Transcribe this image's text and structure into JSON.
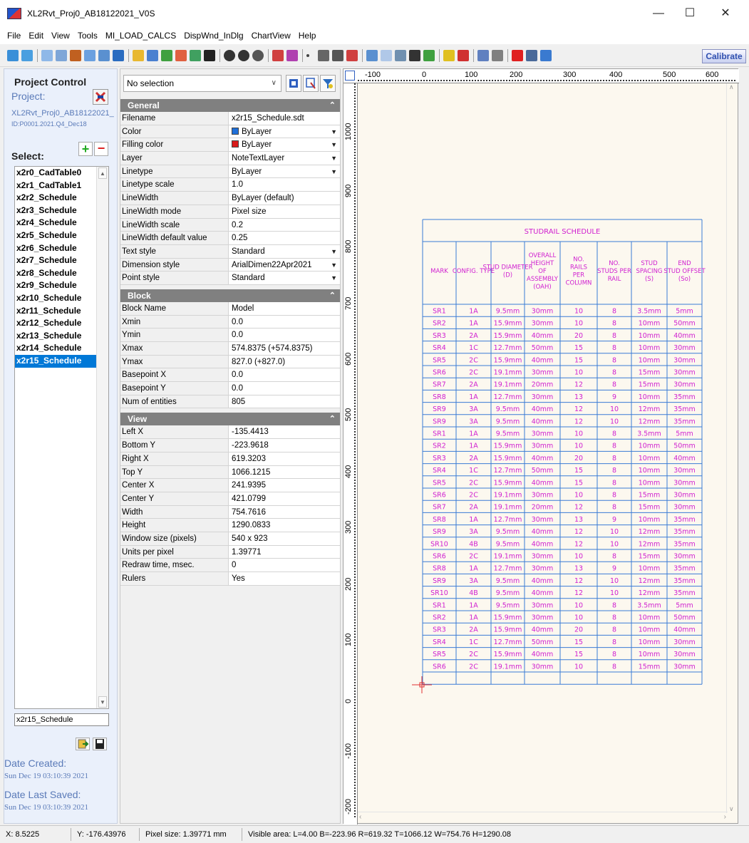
{
  "window": {
    "title": "XL2Rvt_Proj0_AB18122021_V0S",
    "min": "—",
    "max": "☐",
    "close": "✕"
  },
  "menu": [
    "File",
    "Edit",
    "View",
    "Tools",
    "MI_LOAD_CALCS",
    "DispWnd_InDlg",
    "ChartView",
    "Help"
  ],
  "toolbar": {
    "calibrate": "Calibrate"
  },
  "project": {
    "title": "Project Control",
    "label": "Project:",
    "name": "XL2Rvt_Proj0_AB18122021_",
    "id": "ID:P0001.2021.Q4_Dec18",
    "select_label": "Select:",
    "add": "+",
    "remove": "−",
    "items": [
      "x2r0_CadTable0",
      "x2r1_CadTable1",
      "x2r2_Schedule",
      "x2r3_Schedule",
      "x2r4_Schedule",
      "x2r5_Schedule",
      "x2r6_Schedule",
      "x2r7_Schedule",
      "x2r8_Schedule",
      "x2r9_Schedule",
      "x2r10_Schedule",
      "x2r11_Schedule",
      "x2r12_Schedule",
      "x2r13_Schedule",
      "x2r14_Schedule",
      "x2r15_Schedule"
    ],
    "selected_index": 15,
    "name_input": "x2r15_Schedule",
    "date_created_label": "Date Created:",
    "date_created": "Sun Dec 19 03:10:39 2021",
    "date_saved_label": "Date Last Saved:",
    "date_saved": "Sun Dec 19 03:10:39 2021"
  },
  "props": {
    "selection": "No selection",
    "sections": [
      {
        "title": "General",
        "rows": [
          {
            "name": "Filename",
            "value": "x2r15_Schedule.sdt"
          },
          {
            "name": "Color",
            "value": "ByLayer",
            "swatch": "#1e6fd9",
            "dropdown": true
          },
          {
            "name": "Filling color",
            "value": "ByLayer",
            "swatch": "#d81b1b",
            "dropdown": true
          },
          {
            "name": "Layer",
            "value": "NoteTextLayer",
            "dropdown": true
          },
          {
            "name": "Linetype",
            "value": "ByLayer",
            "dropdown": true
          },
          {
            "name": "Linetype scale",
            "value": "1.0"
          },
          {
            "name": "LineWidth",
            "value": "ByLayer (default)"
          },
          {
            "name": "LineWidth mode",
            "value": "Pixel size"
          },
          {
            "name": "LineWidth scale",
            "value": "0.2"
          },
          {
            "name": "LineWidth default value",
            "value": "0.25"
          },
          {
            "name": "Text style",
            "value": "Standard",
            "dropdown": true
          },
          {
            "name": "Dimension style",
            "value": "ArialDimen22Apr2021",
            "dropdown": true
          },
          {
            "name": "Point style",
            "value": "Standard",
            "dropdown": true
          }
        ]
      },
      {
        "title": "Block",
        "rows": [
          {
            "name": "Block Name",
            "value": "Model"
          },
          {
            "name": "Xmin",
            "value": "0.0"
          },
          {
            "name": "Ymin",
            "value": "0.0"
          },
          {
            "name": "Xmax",
            "value": "574.8375  (+574.8375)"
          },
          {
            "name": "Ymax",
            "value": "827.0  (+827.0)"
          },
          {
            "name": "Basepoint X",
            "value": "0.0"
          },
          {
            "name": "Basepoint Y",
            "value": "0.0"
          },
          {
            "name": "Num of entities",
            "value": "805"
          }
        ]
      },
      {
        "title": "View",
        "rows": [
          {
            "name": "Left X",
            "value": "-135.4413"
          },
          {
            "name": "Bottom Y",
            "value": "-223.9618"
          },
          {
            "name": "Right X",
            "value": "619.3203"
          },
          {
            "name": "Top Y",
            "value": "1066.1215"
          },
          {
            "name": "Center X",
            "value": "241.9395"
          },
          {
            "name": "Center Y",
            "value": "421.0799"
          },
          {
            "name": "Width",
            "value": "754.7616"
          },
          {
            "name": "Height",
            "value": "1290.0833"
          },
          {
            "name": "Window size (pixels)",
            "value": "540 x 923"
          },
          {
            "name": "Units per pixel",
            "value": "1.39771"
          },
          {
            "name": "Redraw time, msec.",
            "value": "0"
          },
          {
            "name": "Rulers",
            "value": "Yes"
          }
        ]
      }
    ]
  },
  "rulers": {
    "h": [
      "-100",
      "0",
      "100",
      "200",
      "300",
      "400",
      "500",
      "600"
    ],
    "v": [
      "1000",
      "900",
      "800",
      "700",
      "600",
      "500",
      "400",
      "300",
      "200",
      "100",
      "0",
      "-100",
      "-200"
    ]
  },
  "schedule": {
    "title": "STUDRAIL SCHEDULE",
    "headers": [
      [
        "MARK"
      ],
      [
        "CONFIG. TYPE"
      ],
      [
        "STUD DIAMETER",
        "(D)"
      ],
      [
        "OVERALL",
        "HEIGHT",
        "OF",
        "ASSEMBLY",
        "(OAH)"
      ],
      [
        "NO.",
        "RAILS",
        "PER",
        "COLUMN"
      ],
      [
        "NO.",
        "STUDS PER",
        "RAIL"
      ],
      [
        "STUD",
        "SPACING",
        "(S)"
      ],
      [
        "END",
        "STUD OFFSET",
        "(So)"
      ]
    ],
    "rows": [
      [
        "SR1",
        "1A",
        "9.5mm",
        "30mm",
        "10",
        "8",
        "3.5mm",
        "5mm"
      ],
      [
        "SR2",
        "1A",
        "15.9mm",
        "30mm",
        "10",
        "8",
        "10mm",
        "50mm"
      ],
      [
        "SR3",
        "2A",
        "15.9mm",
        "40mm",
        "20",
        "8",
        "10mm",
        "40mm"
      ],
      [
        "SR4",
        "1C",
        "12.7mm",
        "50mm",
        "15",
        "8",
        "10mm",
        "30mm"
      ],
      [
        "SR5",
        "2C",
        "15.9mm",
        "40mm",
        "15",
        "8",
        "10mm",
        "30mm"
      ],
      [
        "SR6",
        "2C",
        "19.1mm",
        "30mm",
        "10",
        "8",
        "15mm",
        "30mm"
      ],
      [
        "SR7",
        "2A",
        "19.1mm",
        "20mm",
        "12",
        "8",
        "15mm",
        "30mm"
      ],
      [
        "SR8",
        "1A",
        "12.7mm",
        "30mm",
        "13",
        "9",
        "10mm",
        "35mm"
      ],
      [
        "SR9",
        "3A",
        "9.5mm",
        "40mm",
        "12",
        "10",
        "12mm",
        "35mm"
      ],
      [
        "SR9",
        "3A",
        "9.5mm",
        "40mm",
        "12",
        "10",
        "12mm",
        "35mm"
      ],
      [
        "SR1",
        "1A",
        "9.5mm",
        "30mm",
        "10",
        "8",
        "3.5mm",
        "5mm"
      ],
      [
        "SR2",
        "1A",
        "15.9mm",
        "30mm",
        "10",
        "8",
        "10mm",
        "50mm"
      ],
      [
        "SR3",
        "2A",
        "15.9mm",
        "40mm",
        "20",
        "8",
        "10mm",
        "40mm"
      ],
      [
        "SR4",
        "1C",
        "12.7mm",
        "50mm",
        "15",
        "8",
        "10mm",
        "30mm"
      ],
      [
        "SR5",
        "2C",
        "15.9mm",
        "40mm",
        "15",
        "8",
        "10mm",
        "30mm"
      ],
      [
        "SR6",
        "2C",
        "19.1mm",
        "30mm",
        "10",
        "8",
        "15mm",
        "30mm"
      ],
      [
        "SR7",
        "2A",
        "19.1mm",
        "20mm",
        "12",
        "8",
        "15mm",
        "30mm"
      ],
      [
        "SR8",
        "1A",
        "12.7mm",
        "30mm",
        "13",
        "9",
        "10mm",
        "35mm"
      ],
      [
        "SR9",
        "3A",
        "9.5mm",
        "40mm",
        "12",
        "10",
        "12mm",
        "35mm"
      ],
      [
        "SR10",
        "4B",
        "9.5mm",
        "40mm",
        "12",
        "10",
        "12mm",
        "35mm"
      ],
      [
        "SR6",
        "2C",
        "19.1mm",
        "30mm",
        "10",
        "8",
        "15mm",
        "30mm"
      ],
      [
        "SR8",
        "1A",
        "12.7mm",
        "30mm",
        "13",
        "9",
        "10mm",
        "35mm"
      ],
      [
        "SR9",
        "3A",
        "9.5mm",
        "40mm",
        "12",
        "10",
        "12mm",
        "35mm"
      ],
      [
        "SR10",
        "4B",
        "9.5mm",
        "40mm",
        "12",
        "10",
        "12mm",
        "35mm"
      ],
      [
        "SR1",
        "1A",
        "9.5mm",
        "30mm",
        "10",
        "8",
        "3.5mm",
        "5mm"
      ],
      [
        "SR2",
        "1A",
        "15.9mm",
        "30mm",
        "10",
        "8",
        "10mm",
        "50mm"
      ],
      [
        "SR3",
        "2A",
        "15.9mm",
        "40mm",
        "20",
        "8",
        "10mm",
        "40mm"
      ],
      [
        "SR4",
        "1C",
        "12.7mm",
        "50mm",
        "15",
        "8",
        "10mm",
        "30mm"
      ],
      [
        "SR5",
        "2C",
        "15.9mm",
        "40mm",
        "15",
        "8",
        "10mm",
        "30mm"
      ],
      [
        "SR6",
        "2C",
        "19.1mm",
        "30mm",
        "10",
        "8",
        "15mm",
        "30mm"
      ]
    ],
    "line_color": "#3a7bd5",
    "text_color": "#d020d0",
    "origin_color": "#e03030"
  },
  "status": {
    "x": "X: 8.5225",
    "y": "Y: -176.43976",
    "pixel": "Pixel size: 1.39771 mm",
    "visible": "Visible area:  L=4.00  B=-223.96  R=619.32  T=1066.12  W=754.76  H=1290.08"
  }
}
